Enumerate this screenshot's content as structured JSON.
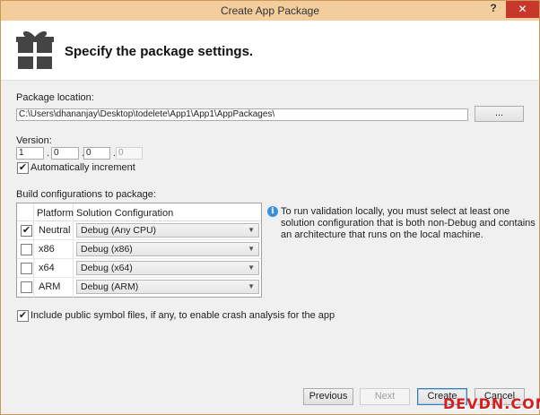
{
  "window": {
    "title": "Create App Package",
    "help_label": "?",
    "close_label": "✕"
  },
  "header": {
    "heading": "Specify the package settings.",
    "icon": "package-gift-icon"
  },
  "package_location": {
    "label": "Package location:",
    "value": "C:\\Users\\dhananjay\\Desktop\\todelete\\App1\\App1\\AppPackages\\",
    "browse_label": "..."
  },
  "version": {
    "label": "Version:",
    "parts": [
      "1",
      "0",
      "0",
      "0"
    ],
    "separator": ".",
    "auto_increment_label": "Automatically increment",
    "auto_increment_checked": true
  },
  "build": {
    "label": "Build configurations to package:",
    "columns": [
      "Platform",
      "Solution Configuration"
    ],
    "rows": [
      {
        "platform": "Neutral",
        "configuration": "Debug (Any CPU)",
        "checked": true
      },
      {
        "platform": "x86",
        "configuration": "Debug (x86)",
        "checked": false
      },
      {
        "platform": "x64",
        "configuration": "Debug (x64)",
        "checked": false
      },
      {
        "platform": "ARM",
        "configuration": "Debug (ARM)",
        "checked": false
      }
    ],
    "info_text": "To run validation locally, you must select at least one solution configuration that is both non-Debug and contains an architecture that runs on the local machine."
  },
  "symbols": {
    "label": "Include public symbol files, if any, to enable crash analysis for the app",
    "checked": true
  },
  "buttons": {
    "previous": "Previous",
    "next": "Next",
    "create": "Create",
    "cancel": "Cancel"
  },
  "watermark": "DEVDN.COM",
  "colors": {
    "titlebar": "#f3cd9b",
    "close": "#c7372c",
    "info": "#3d8ede",
    "watermark": "#d51f1f"
  }
}
